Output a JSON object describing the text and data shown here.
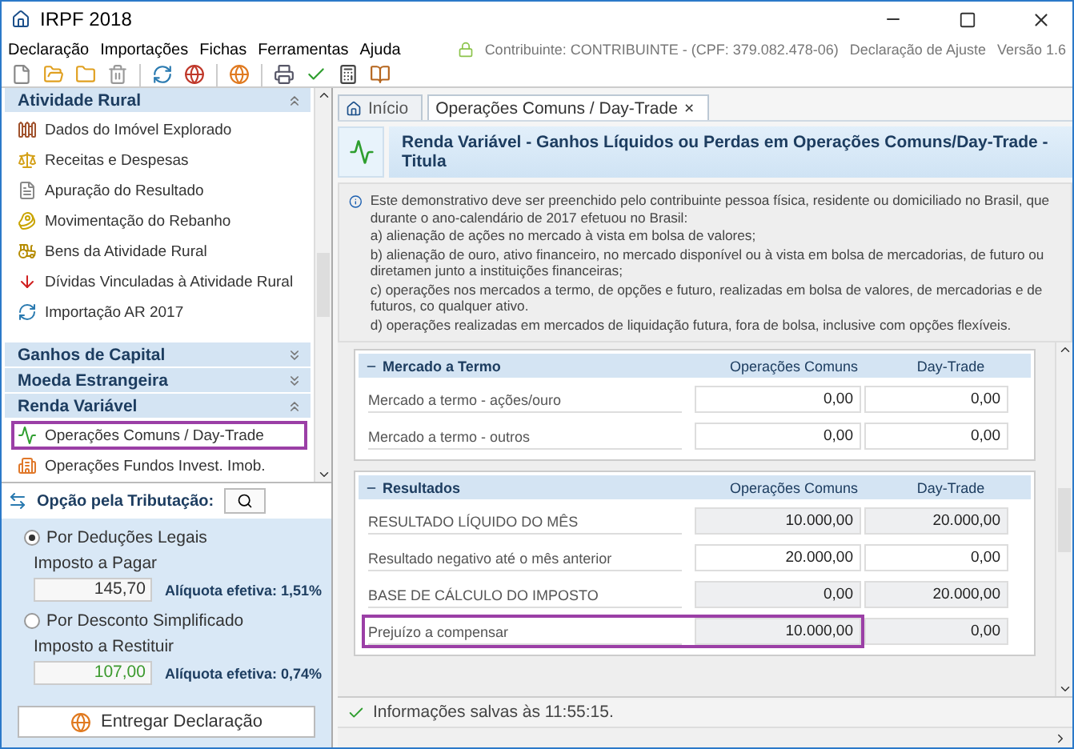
{
  "window": {
    "title": "IRPF 2018"
  },
  "menu": [
    {
      "label": "Declaração"
    },
    {
      "label": "Importações"
    },
    {
      "label": "Fichas"
    },
    {
      "label": "Ferramentas"
    },
    {
      "label": "Ajuda"
    }
  ],
  "info_bar": {
    "taxpayer": "Contribuinte: CONTRIBUINTE - (CPF: 379.082.478-06)",
    "declaration": "Declaração de Ajuste",
    "version": "Versão 1.6"
  },
  "sidebar": {
    "sections": [
      {
        "title": "Atividade Rural",
        "expanded": true,
        "items": [
          {
            "label": "Dados do Imóvel Explorado",
            "selected": false
          },
          {
            "label": "Receitas e Despesas",
            "selected": false
          },
          {
            "label": "Apuração do Resultado",
            "selected": false
          },
          {
            "label": "Movimentação do Rebanho",
            "selected": false
          },
          {
            "label": "Bens da Atividade Rural",
            "selected": false
          },
          {
            "label": "Dívidas Vinculadas à Atividade Rural",
            "selected": false
          },
          {
            "label": "Importação AR 2017",
            "selected": false
          }
        ]
      },
      {
        "title": "Ganhos de Capital",
        "expanded": false
      },
      {
        "title": "Moeda Estrangeira",
        "expanded": false
      },
      {
        "title": "Renda Variável",
        "expanded": true,
        "items": [
          {
            "label": "Operações Comuns / Day-Trade",
            "selected": true
          },
          {
            "label": "Operações Fundos Invest. Imob.",
            "selected": false
          }
        ]
      }
    ]
  },
  "taxation": {
    "title": "Opção pela Tributação:",
    "options": [
      {
        "label": "Por Deduções Legais",
        "selected": true,
        "field_label": "Imposto a Pagar",
        "value": "145,70",
        "kind": "payable",
        "rate": "Alíquota efetiva: 1,51%"
      },
      {
        "label": "Por Desconto Simplificado",
        "selected": false,
        "field_label": "Imposto a Restituir",
        "value": "107,00",
        "kind": "refund",
        "rate": "Alíquota efetiva: 0,74%"
      }
    ],
    "submit": "Entregar Declaração"
  },
  "tabs": [
    {
      "label": "Início",
      "selected": false,
      "closable": false
    },
    {
      "label": "Operações Comuns / Day-Trade",
      "selected": true,
      "closable": true,
      "close": "×"
    }
  ],
  "banner": {
    "title": "Renda Variável - Ganhos Líquidos ou Perdas em Operações Comuns/Day-Trade - Titula"
  },
  "notice": {
    "paragraphs": [
      "Este demonstrativo deve ser preenchido pelo contribuinte pessoa física, residente ou domiciliado no Brasil, que durante o ano-calendário de 2017 efetuou no Brasil:",
      "a) alienação de ações no mercado à vista em bolsa de valores;",
      "b) alienação de ouro, ativo financeiro, no mercado disponível ou à vista em bolsa de mercadorias, de futuro ou diretamen junto a instituições financeiras;",
      "c) operações nos mercados a termo, de opções e futuro, realizadas em bolsa de valores, de mercadorias e de futuros, co qualquer ativo.",
      "d) operações realizadas em mercados de liquidação futura, fora de bolsa, inclusive com opções flexíveis."
    ]
  },
  "groups": [
    {
      "title": "Mercado a Termo",
      "expanded": true,
      "columns": [
        "Operações Comuns",
        "Day-Trade"
      ],
      "rows": [
        {
          "label": "Mercado a termo - ações/ouro",
          "common": "0,00",
          "daytrade": "0,00",
          "readonly": false,
          "highlighted": false
        },
        {
          "label": "Mercado a termo - outros",
          "common": "0,00",
          "daytrade": "0,00",
          "readonly": false,
          "highlighted": false
        }
      ]
    },
    {
      "title": "Resultados",
      "expanded": true,
      "columns": [
        "Operações Comuns",
        "Day-Trade"
      ],
      "rows": [
        {
          "label": "RESULTADO LÍQUIDO DO MÊS",
          "common": "10.000,00",
          "daytrade": "20.000,00",
          "readonly": true,
          "highlighted": false
        },
        {
          "label": "Resultado negativo até o mês anterior",
          "common": "20.000,00",
          "daytrade": "0,00",
          "readonly": false,
          "highlighted": false
        },
        {
          "label": "BASE DE CÁLCULO DO IMPOSTO",
          "common": "0,00",
          "daytrade": "20.000,00",
          "readonly": true,
          "highlighted": false
        },
        {
          "label": "Prejuízo a compensar",
          "common": "10.000,00",
          "daytrade": "0,00",
          "readonly": true,
          "highlighted": true
        }
      ]
    }
  ],
  "status_bar": {
    "message": "Informações salvas às 11:55:15."
  }
}
